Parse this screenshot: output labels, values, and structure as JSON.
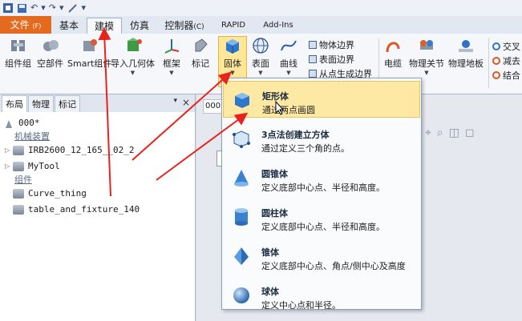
{
  "quick_access": {
    "undo_symbol": "↶",
    "redo_symbol": "↷",
    "dropdown_symbol": "▾"
  },
  "tabs": [
    {
      "label": "文件",
      "key": "(F)"
    },
    {
      "label": "基本"
    },
    {
      "label": "建模"
    },
    {
      "label": "仿真"
    },
    {
      "label": "控制器",
      "key": "(C)"
    },
    {
      "label": "RAPID"
    },
    {
      "label": "Add-Ins"
    }
  ],
  "ribbon": {
    "component_group": "组件组",
    "empty_part": "空部件",
    "smart_component": "Smart组件",
    "import_geometry": "导入几何体",
    "frame": "框架",
    "marker": "标记",
    "solid": "固体",
    "surface": "表面",
    "curve": "曲线",
    "body_edge": "物体边界",
    "surface_edge": "表面边界",
    "edge_from_points": "从点生成边界",
    "cable": "电缆",
    "mechanism_joint": "物理关节",
    "physics_floor": "物理地板",
    "intersect": "交叉",
    "subtract": "减去",
    "union": "结合"
  },
  "layout_panel": {
    "tabs": [
      "布局",
      "物理",
      "标记"
    ],
    "pin_symbol": "▾",
    "close_symbol": "×",
    "station_name": "000*",
    "mechanisms_heading": "机械装置",
    "robot": "IRB2600_12_165__02_2",
    "tool": "MyTool",
    "components_heading": "组件",
    "component1": "Curve_thing",
    "component2": "table_and_fixture_140"
  },
  "view": {
    "tab_label": "000"
  },
  "solid_menu": {
    "items": [
      {
        "title": "矩形体",
        "desc": "通过两点画圆"
      },
      {
        "title": "3点法创建立方体",
        "desc": "通过定义三个角的点。"
      },
      {
        "title": "圆锥体",
        "desc": "定义底部中心点、半径和高度。"
      },
      {
        "title": "圆柱体",
        "desc": "定义底部中心点、半径和高度。"
      },
      {
        "title": "锥体",
        "desc": "定义底部中心点、角点/侧中心及高度"
      },
      {
        "title": "球体",
        "desc": "定义中心点和半径。"
      }
    ]
  },
  "colors": {
    "file_tab": "#e36a1e",
    "hover": "#fde9a3",
    "arrow": "#e8231c"
  }
}
